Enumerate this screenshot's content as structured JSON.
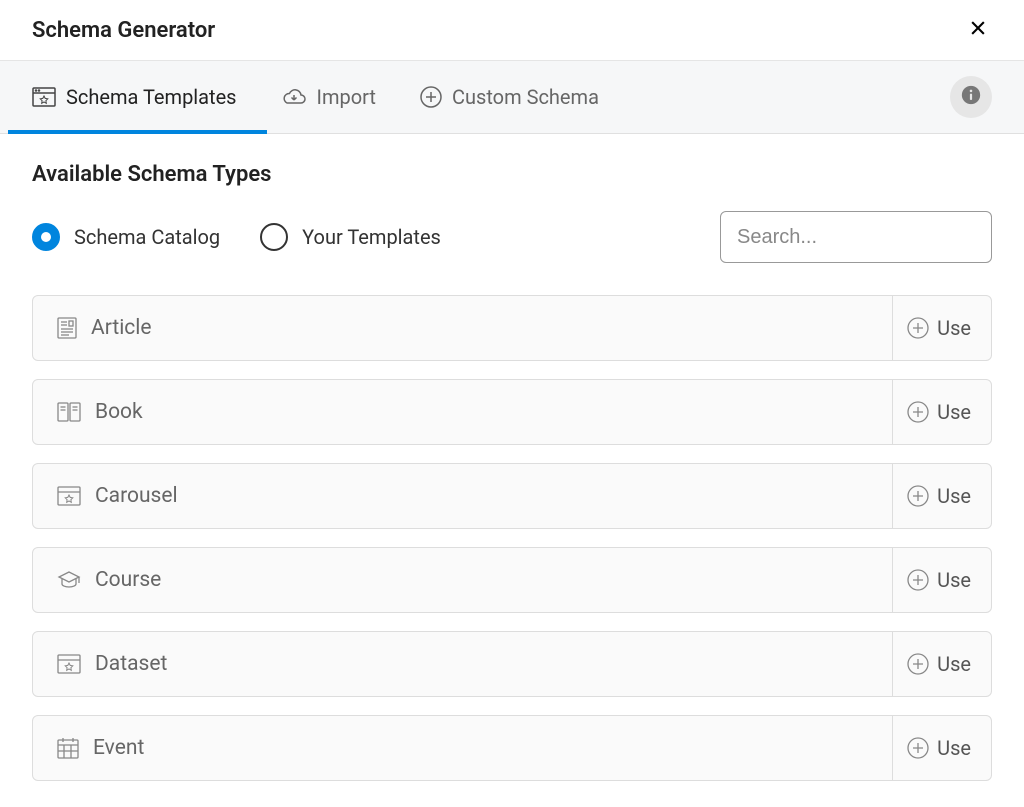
{
  "header": {
    "title": "Schema Generator"
  },
  "tabs": {
    "schema_templates": "Schema Templates",
    "import": "Import",
    "custom_schema": "Custom Schema"
  },
  "section_title": "Available Schema Types",
  "radios": {
    "catalog": "Schema Catalog",
    "your_templates": "Your Templates"
  },
  "search": {
    "placeholder": "Search..."
  },
  "use_label": "Use",
  "items": [
    {
      "name": "Article"
    },
    {
      "name": "Book"
    },
    {
      "name": "Carousel"
    },
    {
      "name": "Course"
    },
    {
      "name": "Dataset"
    },
    {
      "name": "Event"
    }
  ]
}
